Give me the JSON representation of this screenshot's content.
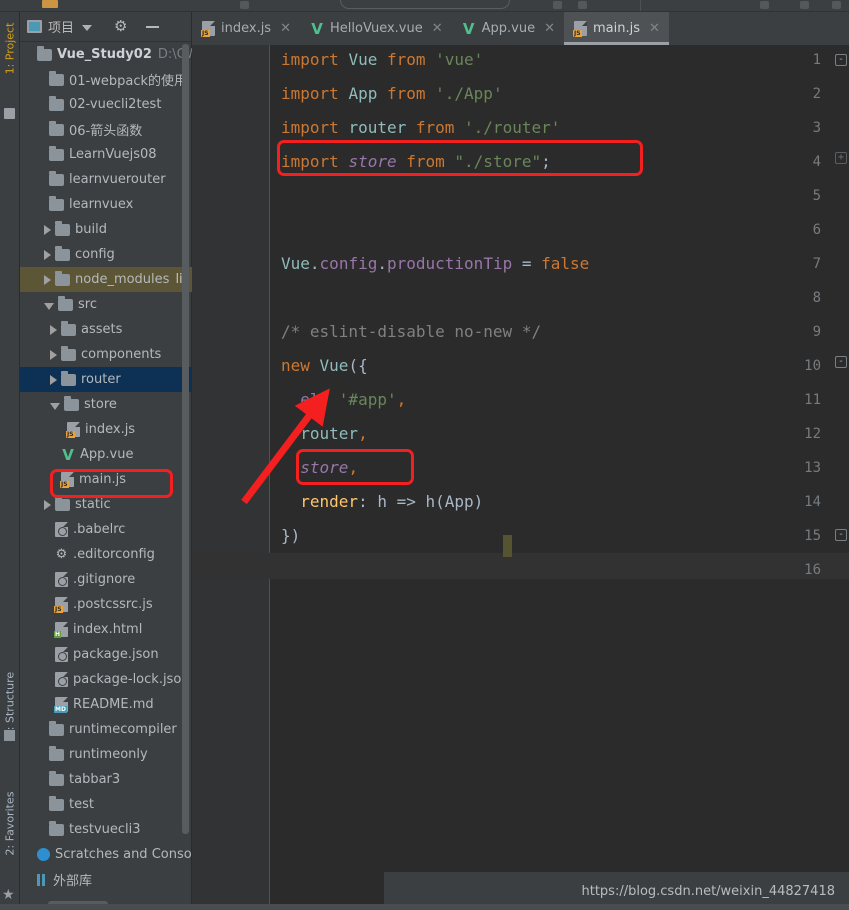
{
  "window": {
    "left_strip": [
      {
        "label": "1: Project",
        "active": true
      },
      {
        "label": "7: Structure",
        "active": false
      },
      {
        "label": "2: Favorites",
        "active": false
      }
    ]
  },
  "project_panel": {
    "title": "项目",
    "icons": {
      "panel": "project-icon",
      "dropdown": "chevron-down-icon",
      "settings": "gear-icon",
      "hide": "minimize-icon"
    },
    "tree": [
      {
        "label": "Vue_Study02",
        "path": "D:\\CWor",
        "type": "root",
        "arrow": "none",
        "depth": 0
      },
      {
        "label": "01-webpack的使用",
        "type": "folder",
        "arrow": "none",
        "depth": 1
      },
      {
        "label": "02-vuecli2test",
        "type": "folder",
        "arrow": "none",
        "depth": 1
      },
      {
        "label": "06-箭头函数",
        "type": "folder",
        "arrow": "none",
        "depth": 1
      },
      {
        "label": "LearnVuejs08",
        "type": "folder",
        "arrow": "none",
        "depth": 1
      },
      {
        "label": "learnvuerouter",
        "type": "folder",
        "arrow": "none",
        "depth": 1
      },
      {
        "label": "learnvuex",
        "type": "folder",
        "arrow": "none",
        "depth": 1
      },
      {
        "label": "build",
        "type": "folder",
        "arrow": "closed",
        "depth": 2
      },
      {
        "label": "config",
        "type": "folder",
        "arrow": "closed",
        "depth": 2
      },
      {
        "label": "node_modules",
        "type": "folder",
        "arrow": "closed",
        "depth": 2,
        "highlight": "olive",
        "suffix": "li"
      },
      {
        "label": "src",
        "type": "folder",
        "arrow": "open",
        "depth": 2
      },
      {
        "label": "assets",
        "type": "folder",
        "arrow": "closed",
        "depth": 3
      },
      {
        "label": "components",
        "type": "folder",
        "arrow": "closed",
        "depth": 3
      },
      {
        "label": "router",
        "type": "folder",
        "arrow": "closed",
        "depth": 3,
        "highlight": "blue"
      },
      {
        "label": "store",
        "type": "folder",
        "arrow": "open",
        "depth": 3
      },
      {
        "label": "index.js",
        "type": "js",
        "arrow": "none",
        "depth": 4
      },
      {
        "label": "App.vue",
        "type": "vue",
        "arrow": "none",
        "depth": 3
      },
      {
        "label": "main.js",
        "type": "js",
        "arrow": "none",
        "depth": 3,
        "annotated": true
      },
      {
        "label": "static",
        "type": "folder",
        "arrow": "closed",
        "depth": 2
      },
      {
        "label": ".babelrc",
        "type": "cfg",
        "arrow": "none",
        "depth": 2
      },
      {
        "label": ".editorconfig",
        "type": "gearfile",
        "arrow": "none",
        "depth": 2
      },
      {
        "label": ".gitignore",
        "type": "cfg",
        "arrow": "none",
        "depth": 2
      },
      {
        "label": ".postcssrc.js",
        "type": "js",
        "arrow": "none",
        "depth": 2
      },
      {
        "label": "index.html",
        "type": "html",
        "arrow": "none",
        "depth": 2
      },
      {
        "label": "package.json",
        "type": "cfg",
        "arrow": "none",
        "depth": 2
      },
      {
        "label": "package-lock.jso",
        "type": "cfg",
        "arrow": "none",
        "depth": 2
      },
      {
        "label": "README.md",
        "type": "md",
        "arrow": "none",
        "depth": 2
      },
      {
        "label": "runtimecompiler",
        "type": "folder",
        "arrow": "none",
        "depth": 1
      },
      {
        "label": "runtimeonly",
        "type": "folder",
        "arrow": "none",
        "depth": 1
      },
      {
        "label": "tabbar3",
        "type": "folder",
        "arrow": "none",
        "depth": 1
      },
      {
        "label": "test",
        "type": "folder",
        "arrow": "none",
        "depth": 1
      },
      {
        "label": "testvuecli3",
        "type": "folder",
        "arrow": "none",
        "depth": 1
      },
      {
        "label": "Scratches and Consoles",
        "type": "scratch",
        "arrow": "none",
        "depth": 0
      },
      {
        "label": "外部库",
        "type": "extlib",
        "arrow": "none",
        "depth": 0
      }
    ]
  },
  "editor": {
    "tabs": [
      {
        "label": "index.js",
        "icon": "js-file-icon",
        "active": false
      },
      {
        "label": "HelloVuex.vue",
        "icon": "vue-file-icon",
        "active": false
      },
      {
        "label": "App.vue",
        "icon": "vue-file-icon",
        "active": false
      },
      {
        "label": "main.js",
        "icon": "js-file-icon",
        "active": true
      }
    ],
    "line_numbers": [
      "1",
      "2",
      "3",
      "4",
      "5",
      "6",
      "7",
      "8",
      "9",
      "10",
      "11",
      "12",
      "13",
      "14",
      "15",
      "16"
    ],
    "code_lines": [
      {
        "n": 1,
        "tokens": [
          {
            "t": "import ",
            "c": "kw"
          },
          {
            "t": "Vue",
            "c": "cls"
          },
          {
            "t": " from ",
            "c": "kw"
          },
          {
            "t": "'vue'",
            "c": "str"
          }
        ]
      },
      {
        "n": 2,
        "tokens": [
          {
            "t": "import ",
            "c": "kw"
          },
          {
            "t": "App",
            "c": "cls"
          },
          {
            "t": " from ",
            "c": "kw"
          },
          {
            "t": "'./App'",
            "c": "str"
          }
        ]
      },
      {
        "n": 3,
        "tokens": [
          {
            "t": "import ",
            "c": "kw"
          },
          {
            "t": "router",
            "c": "cls"
          },
          {
            "t": " from ",
            "c": "kw"
          },
          {
            "t": "'./router'",
            "c": "str"
          }
        ]
      },
      {
        "n": 4,
        "tokens": [
          {
            "t": "import ",
            "c": "kw"
          },
          {
            "t": "store",
            "c": "fieldital"
          },
          {
            "t": " from ",
            "c": "kw"
          },
          {
            "t": "\"./store\"",
            "c": "str"
          },
          {
            "t": ";",
            "c": "punc"
          }
        ]
      },
      {
        "n": 5,
        "tokens": []
      },
      {
        "n": 6,
        "tokens": []
      },
      {
        "n": 7,
        "tokens": [
          {
            "t": "Vue",
            "c": "cls"
          },
          {
            "t": ".",
            "c": "punc"
          },
          {
            "t": "config",
            "c": "field"
          },
          {
            "t": ".",
            "c": "punc"
          },
          {
            "t": "productionTip",
            "c": "field"
          },
          {
            "t": " = ",
            "c": "punc"
          },
          {
            "t": "false",
            "c": "kw"
          }
        ]
      },
      {
        "n": 8,
        "tokens": []
      },
      {
        "n": 9,
        "tokens": [
          {
            "t": "/* eslint-disable no-new */",
            "c": "cmt"
          }
        ]
      },
      {
        "n": 10,
        "tokens": [
          {
            "t": "new ",
            "c": "kw"
          },
          {
            "t": "Vue",
            "c": "cls"
          },
          {
            "t": "({",
            "c": "punc"
          }
        ]
      },
      {
        "n": 11,
        "tokens": [
          {
            "t": "  ",
            "c": "punc"
          },
          {
            "t": "el",
            "c": "field"
          },
          {
            "t": ": ",
            "c": "punc"
          },
          {
            "t": "'#app'",
            "c": "str"
          },
          {
            "t": ",",
            "c": "kw"
          }
        ]
      },
      {
        "n": 12,
        "tokens": [
          {
            "t": "  ",
            "c": "punc"
          },
          {
            "t": "router",
            "c": "cls"
          },
          {
            "t": ",",
            "c": "kw"
          }
        ]
      },
      {
        "n": 13,
        "tokens": [
          {
            "t": "  ",
            "c": "punc"
          },
          {
            "t": "store",
            "c": "fieldital"
          },
          {
            "t": ",",
            "c": "kw"
          }
        ]
      },
      {
        "n": 14,
        "tokens": [
          {
            "t": "  ",
            "c": "punc"
          },
          {
            "t": "render",
            "c": "fn"
          },
          {
            "t": ": h => h(App)",
            "c": "ident"
          }
        ]
      },
      {
        "n": 15,
        "tokens": [
          {
            "t": "})",
            "c": "punc"
          }
        ]
      },
      {
        "n": 16,
        "tokens": []
      }
    ]
  },
  "annotations": {
    "red_boxes": [
      "import-store-line",
      "store-property-line",
      "main-js-tree-item"
    ],
    "arrow": "red-arrow-from-main-js-to-store",
    "color": "#f41f1f"
  },
  "watermark": {
    "text": "https://blog.csdn.net/weixin_44827418"
  }
}
